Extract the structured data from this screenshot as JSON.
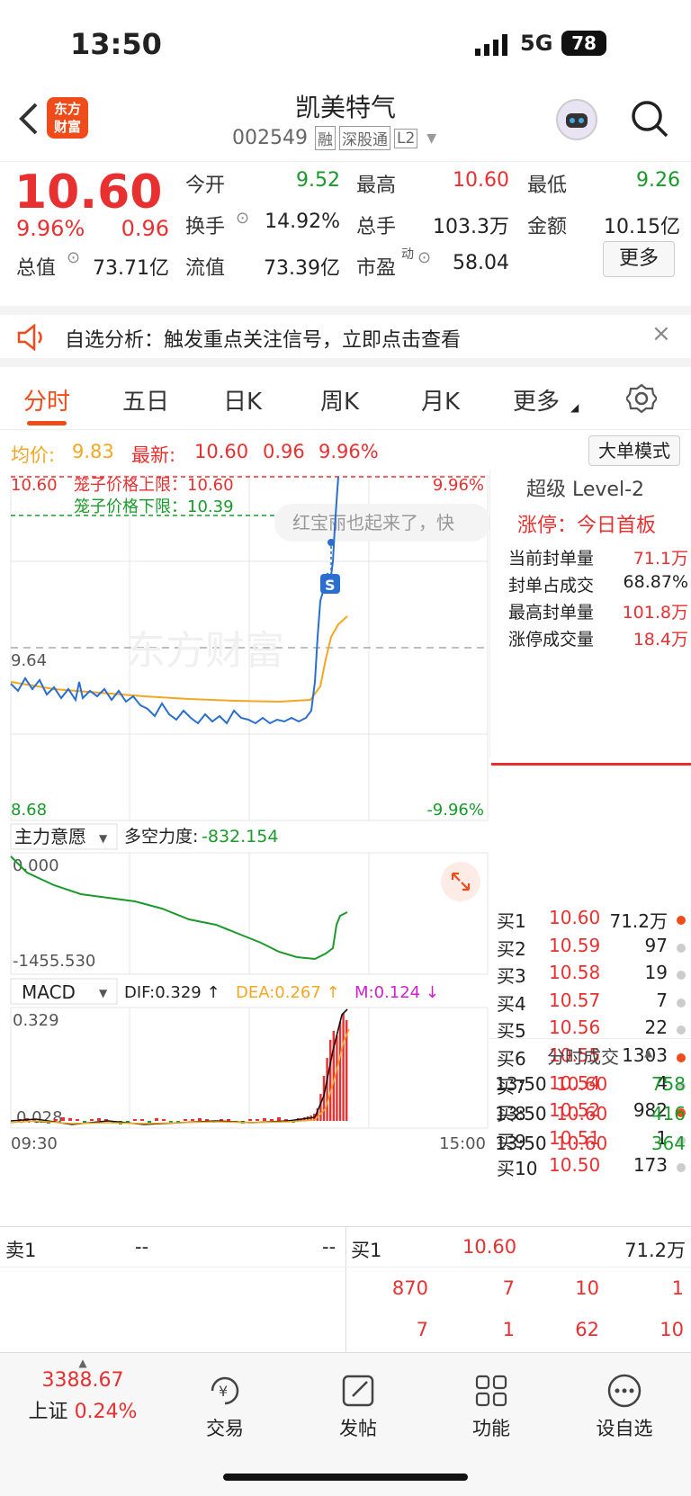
{
  "status": {
    "time": "13:50",
    "network": "5G",
    "battery": "78"
  },
  "header": {
    "logo_line1": "东方",
    "logo_line2": "财富",
    "title": "凯美特气",
    "code": "002549",
    "tags": [
      "融",
      "深股通",
      "L2"
    ]
  },
  "quote": {
    "price": "10.60",
    "change_pct": "9.96%",
    "change": "0.96",
    "open_label": "今开",
    "open": "9.52",
    "high_label": "最高",
    "high": "10.60",
    "low_label": "最低",
    "low": "9.26",
    "turnover_label": "换手",
    "turnover": "14.92%",
    "volume_label": "总手",
    "volume": "103.3万",
    "amount_label": "金额",
    "amount": "10.15亿",
    "mcap_label": "总值",
    "mcap": "73.71亿",
    "float_label": "流值",
    "float_cap": "73.39亿",
    "pe_label": "市盈",
    "pe_sup": "动",
    "pe": "58.04",
    "more": "更多"
  },
  "notice": {
    "text": "自选分析：触发重点关注信号，立即点击查看",
    "close": "×"
  },
  "tabs": [
    "分时",
    "五日",
    "日K",
    "周K",
    "月K",
    "更多"
  ],
  "info": {
    "avg_label": "均价:",
    "avg": "9.83",
    "last_label": "最新:",
    "last": "10.60",
    "chg": "0.96",
    "pct": "9.96%",
    "mode_btn": "大单模式"
  },
  "chart": {
    "top_price": "10.60",
    "top_pct": "9.96%",
    "bottom_price": "8.68",
    "bottom_pct": "-9.96%",
    "mid_price": "9.64",
    "upper_limit": "笼子价格上限：10.60",
    "lower_limit": "笼子价格下限：10.39",
    "watermark": "东方财富",
    "comment": "红宝丽也起来了，快",
    "marker": "S",
    "start_time": "09:30",
    "end_time": "15:00"
  },
  "indicator": {
    "name": "主力意愿",
    "label": "多空力度:",
    "value": "-832.154",
    "top": "0.000",
    "bottom": "-1455.530"
  },
  "macd": {
    "name": "MACD",
    "dif": "DIF:0.329 ↑",
    "dea": "DEA:0.267 ↑",
    "m": "M:0.124 ↓",
    "top": "0.329",
    "bottom": "0.028"
  },
  "level2": {
    "title": "超级 Level-2",
    "status": "涨停：今日首板",
    "rows": [
      {
        "label": "当前封单量",
        "value": "71.1万"
      },
      {
        "label": "封单占成交",
        "value": "68.87%"
      },
      {
        "label": "最高封单量",
        "value": "101.8万"
      },
      {
        "label": "涨停成交量",
        "value": "18.4万"
      }
    ]
  },
  "orderbook": [
    {
      "label": "买1",
      "price": "10.60",
      "vol": "71.2万"
    },
    {
      "label": "买2",
      "price": "10.59",
      "vol": "97"
    },
    {
      "label": "买3",
      "price": "10.58",
      "vol": "19"
    },
    {
      "label": "买4",
      "price": "10.57",
      "vol": "7"
    },
    {
      "label": "买5",
      "price": "10.56",
      "vol": "22"
    },
    {
      "label": "买6",
      "price": "10.55",
      "vol": "1303"
    },
    {
      "label": "买7",
      "price": "10.54",
      "vol": "4"
    },
    {
      "label": "买8",
      "price": "10.52",
      "vol": "982"
    },
    {
      "label": "买9",
      "price": "10.51",
      "vol": "1"
    },
    {
      "label": "买10",
      "price": "10.50",
      "vol": "173"
    }
  ],
  "trades": {
    "title": "分时成交",
    "rows": [
      {
        "time": "13:50",
        "price": "10.60",
        "vol": "758"
      },
      {
        "time": "13:50",
        "price": "10.60",
        "vol": "416"
      },
      {
        "time": "13:50",
        "price": "10.60",
        "vol": "364"
      }
    ]
  },
  "bottom": {
    "sell_label": "卖1",
    "sell_price": "--",
    "sell_vol": "--",
    "buy_label": "买1",
    "buy_price": "10.60",
    "buy_vol": "71.2万",
    "q1": [
      "870",
      "7",
      "10",
      "1"
    ],
    "q2": [
      "7",
      "1",
      "62",
      "10"
    ]
  },
  "nav": {
    "index_value": "3388.67",
    "index_name": "上证",
    "index_pct": "0.24%",
    "items": [
      "交易",
      "发帖",
      "功能",
      "设自选"
    ]
  },
  "colors": {
    "up": "#e93030",
    "down": "#1a9a2a",
    "accent": "#f04b1a",
    "price_line": "#2a6fd0",
    "avg_line": "#f5a623"
  }
}
